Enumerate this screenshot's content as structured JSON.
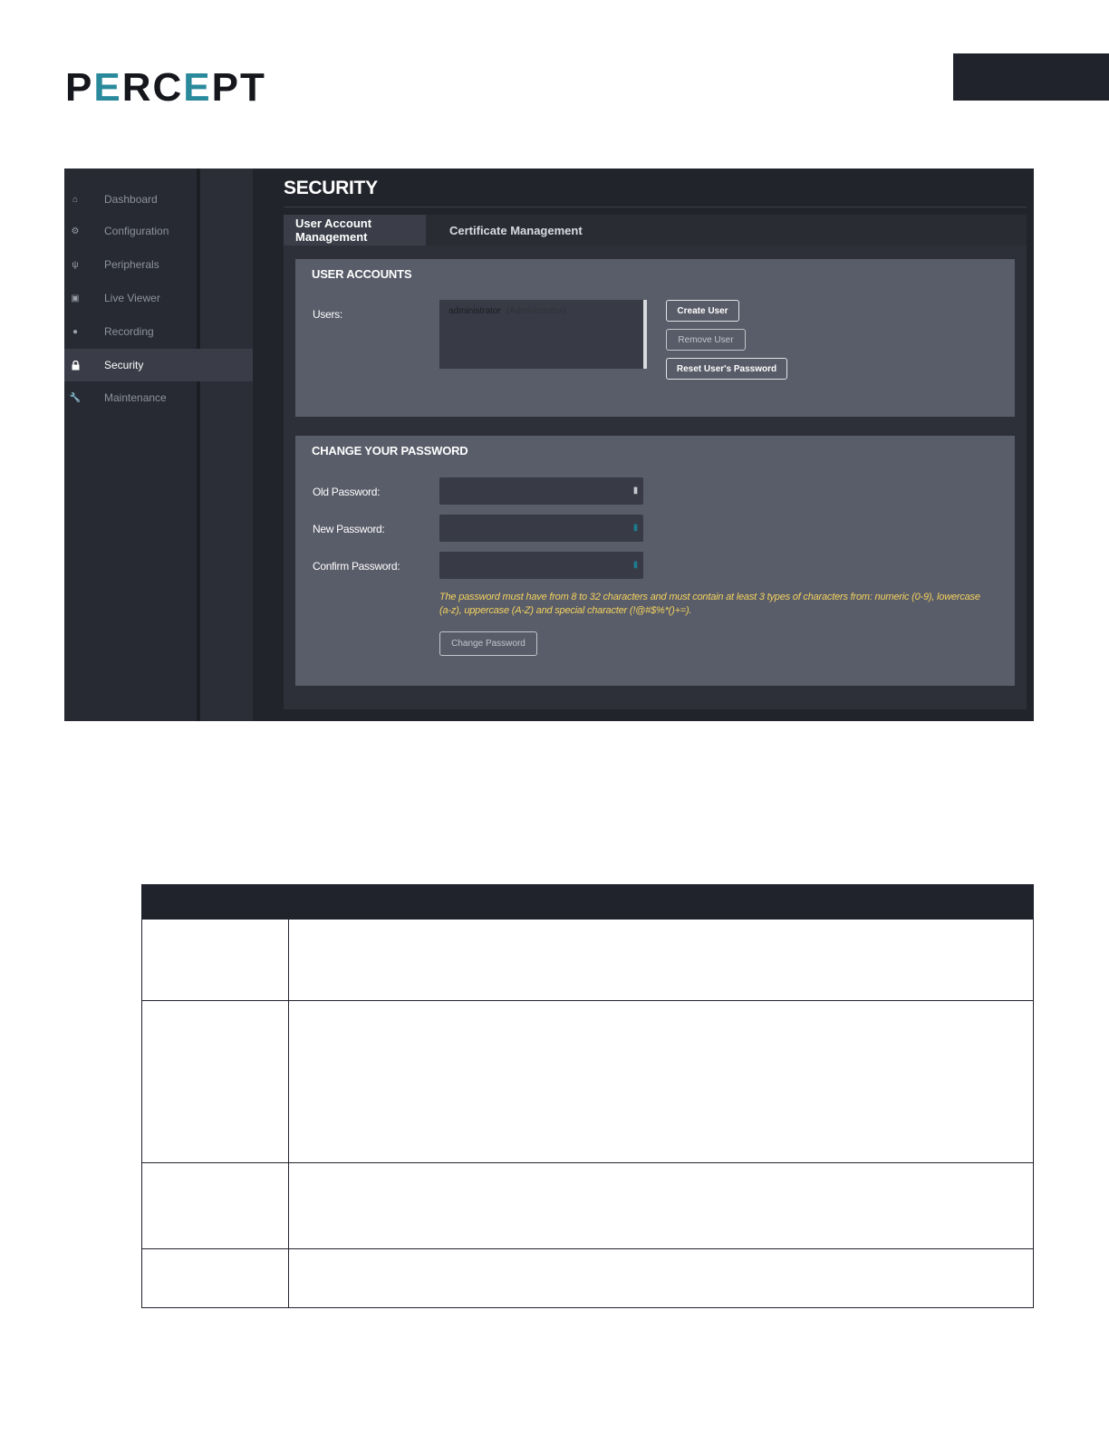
{
  "brand": {
    "logo_left": "P",
    "logo_accent_1": "E",
    "logo_mid": "RC",
    "logo_accent_2": "E",
    "logo_right": "PT"
  },
  "sidebar": {
    "items": [
      {
        "label": "Dashboard",
        "icon": "home-icon",
        "active": false
      },
      {
        "label": "Configuration",
        "icon": "gear-icon",
        "active": false
      },
      {
        "label": "Peripherals",
        "icon": "usb-icon",
        "active": false
      },
      {
        "label": "Live Viewer",
        "icon": "camera-icon",
        "active": false
      },
      {
        "label": "Recording",
        "icon": "record-dot-icon",
        "active": false
      },
      {
        "label": "Security",
        "icon": "lock-icon",
        "active": true
      },
      {
        "label": "Maintenance",
        "icon": "wrench-icon",
        "active": false
      }
    ]
  },
  "page": {
    "title": "SECURITY",
    "tabs": [
      {
        "label": "User Account Management",
        "active": true
      },
      {
        "label": "Certificate Management",
        "active": false
      }
    ]
  },
  "user_accounts": {
    "title": "USER ACCOUNTS",
    "users_label": "Users:",
    "users": [
      {
        "name": "administrator",
        "role": "(Administrator)"
      }
    ],
    "create_user": "Create User",
    "remove_user": "Remove User",
    "reset_password": "Reset User's Password"
  },
  "change_password": {
    "title": "CHANGE YOUR PASSWORD",
    "old_label": "Old Password:",
    "new_label": "New Password:",
    "confirm_label": "Confirm Password:",
    "hint": "The password must have from 8 to 32 characters and must contain at least 3 types of characters from: numeric (0-9), lowercase (a-z), uppercase (A-Z) and special character (!@#$%*()+=).",
    "submit": "Change Password"
  },
  "colors": {
    "accent": "#2a8a9c",
    "hint": "#f4d35e",
    "header_dark": "#21232c"
  }
}
